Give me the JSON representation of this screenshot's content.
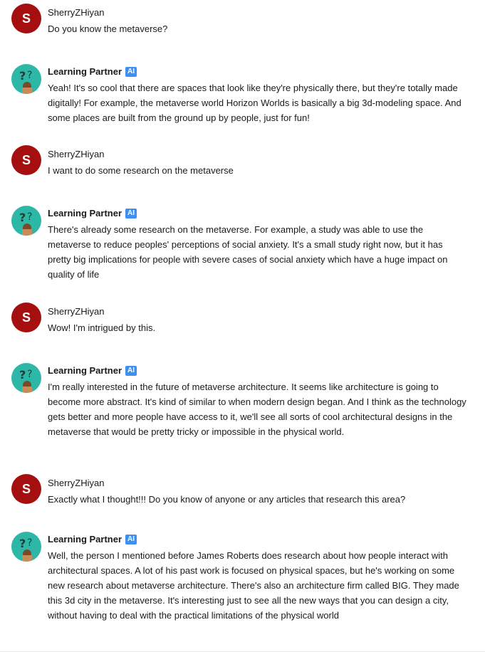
{
  "messages": [
    {
      "role": "user",
      "avatar_letter": "S",
      "name": "SherryZHiyan",
      "text": "Do you know the metaverse?"
    },
    {
      "role": "ai",
      "name": "Learning Partner",
      "badge": "AI",
      "text": "Yeah! It's so cool that there are spaces that look like they're physically there, but they're totally made digitally! For example, the metaverse world Horizon Worlds is basically a big 3d-modeling space. And some places are built from the ground up by people, just for fun!"
    },
    {
      "role": "user",
      "avatar_letter": "S",
      "name": "SherryZHiyan",
      "text": "I want to do some research on the metaverse"
    },
    {
      "role": "ai",
      "name": "Learning Partner",
      "badge": "AI",
      "text": "There's already some research on the metaverse. For example, a study was able to use the metaverse to reduce peoples' perceptions of social anxiety. It's a small study right now, but it has pretty big implications for people with severe cases of social anxiety which have a huge impact on quality of life"
    },
    {
      "role": "user",
      "avatar_letter": "S",
      "name": "SherryZHiyan",
      "text": "Wow! I'm intrigued by this."
    },
    {
      "role": "ai",
      "name": "Learning Partner",
      "badge": "AI",
      "text": "I'm really interested in the future of metaverse architecture. It seems like architecture is going to become more abstract. It's kind of similar to when modern design began. And I think as the technology gets better and more people have access to it, we'll see all sorts of cool architectural designs in the metaverse that would be pretty tricky or impossible in the physical world."
    },
    {
      "role": "user",
      "avatar_letter": "S",
      "name": "SherryZHiyan",
      "text": "Exactly what I thought!!! Do you know of anyone or any articles that research this area?"
    },
    {
      "role": "ai",
      "name": "Learning Partner",
      "badge": "AI",
      "text": "Well, the person I mentioned before James Roberts does research about how people interact with architectural spaces. A lot of his past work is focused on physical spaces, but he's working on some new research about metaverse architecture. There's also an architecture firm called BIG. They made this 3d city in the metaverse. It's interesting just to see all the new ways that you can design a city, without having to deal with the practical limitations of the physical world"
    }
  ],
  "colors": {
    "user_avatar": "#a50f0f",
    "ai_avatar": "#2cb7a7",
    "badge": "#3f8ff0"
  },
  "icons": {
    "ai_avatar": "question-marks-character-icon"
  }
}
